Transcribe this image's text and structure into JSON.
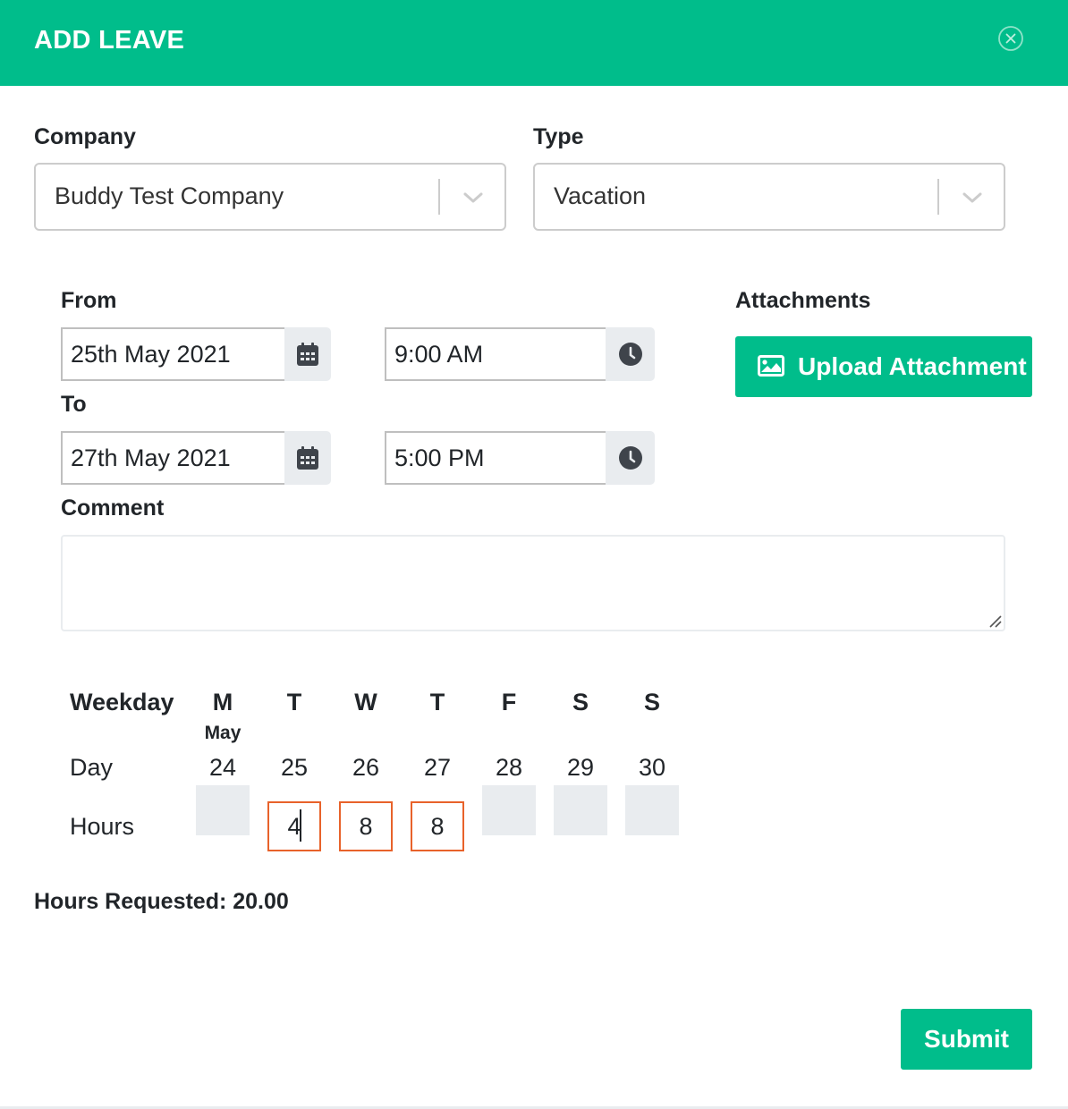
{
  "header": {
    "title": "ADD LEAVE",
    "close_icon": "close-circle-icon",
    "accent_color": "#00bd8b"
  },
  "company": {
    "label": "Company",
    "value": "Buddy Test Company"
  },
  "type": {
    "label": "Type",
    "value": "Vacation"
  },
  "from": {
    "label": "From",
    "date": "25th May 2021",
    "time": "9:00 AM"
  },
  "to": {
    "label": "To",
    "date": "27th May 2021",
    "time": "5:00 PM"
  },
  "attachments": {
    "label": "Attachments",
    "upload_label": "Upload Attachment",
    "upload_icon": "image-icon"
  },
  "comment": {
    "label": "Comment",
    "value": ""
  },
  "schedule": {
    "weekday_label": "Weekday",
    "day_label": "Day",
    "hours_label": "Hours",
    "month_label": "May",
    "days": [
      {
        "weekday": "M",
        "day": "24",
        "hours": null,
        "editable": false
      },
      {
        "weekday": "T",
        "day": "25",
        "hours": "4",
        "editable": true
      },
      {
        "weekday": "W",
        "day": "26",
        "hours": "8",
        "editable": true
      },
      {
        "weekday": "T",
        "day": "27",
        "hours": "8",
        "editable": true
      },
      {
        "weekday": "F",
        "day": "28",
        "hours": null,
        "editable": false
      },
      {
        "weekday": "S",
        "day": "29",
        "hours": null,
        "editable": false
      },
      {
        "weekday": "S",
        "day": "30",
        "hours": null,
        "editable": false
      }
    ],
    "highlight_color": "#e8622a"
  },
  "summary": {
    "text": "Hours Requested: 20.00"
  },
  "footer": {
    "submit_label": "Submit"
  }
}
